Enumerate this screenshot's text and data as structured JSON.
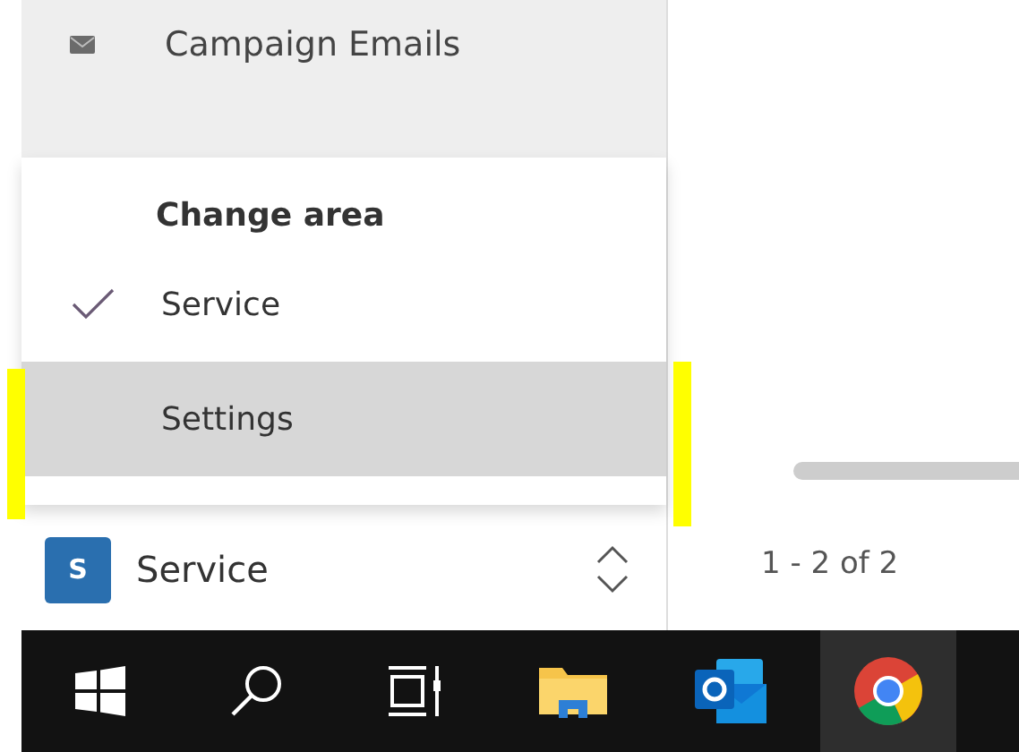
{
  "nav_item": {
    "label": "Campaign Emails"
  },
  "area_menu": {
    "title": "Change area",
    "items": [
      {
        "label": "Service",
        "checked": true,
        "highlighted": false
      },
      {
        "label": "Settings",
        "checked": false,
        "highlighted": true
      }
    ]
  },
  "area_switcher": {
    "badge": "S",
    "label": "Service"
  },
  "pager": {
    "text": "1 - 2 of 2"
  },
  "taskbar": {
    "items": [
      {
        "kind": "start",
        "active": false
      },
      {
        "kind": "search",
        "active": false
      },
      {
        "kind": "taskview",
        "active": false
      },
      {
        "kind": "explorer",
        "active": false
      },
      {
        "kind": "outlook",
        "active": false
      },
      {
        "kind": "chrome",
        "active": true
      }
    ]
  }
}
